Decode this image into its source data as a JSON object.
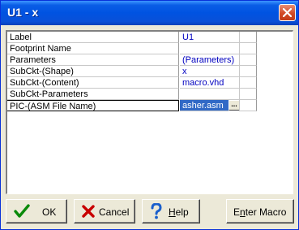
{
  "window": {
    "title": "U1 - x"
  },
  "properties": [
    {
      "name": "Label",
      "value": "U1"
    },
    {
      "name": "Footprint Name",
      "value": ""
    },
    {
      "name": "Parameters",
      "value": "(Parameters)"
    },
    {
      "name": "SubCkt-(Shape)",
      "value": "x"
    },
    {
      "name": "SubCkt-(Content)",
      "value": "macro.vhd"
    },
    {
      "name": "SubCkt-Parameters",
      "value": ""
    },
    {
      "name": "PIC-(ASM File Name)",
      "value": "asher.asm",
      "selected": true
    }
  ],
  "ellipsis_label": "...",
  "buttons": {
    "ok": "OK",
    "cancel": "Cancel",
    "help_underlined": "H",
    "help_rest": "elp",
    "enter_macro_pre": "E",
    "enter_macro_underlined": "n",
    "enter_macro_rest": "ter Macro"
  },
  "colors": {
    "title_bar": "#0053e1",
    "value_text": "#0000c0",
    "selection": "#3169c6"
  }
}
